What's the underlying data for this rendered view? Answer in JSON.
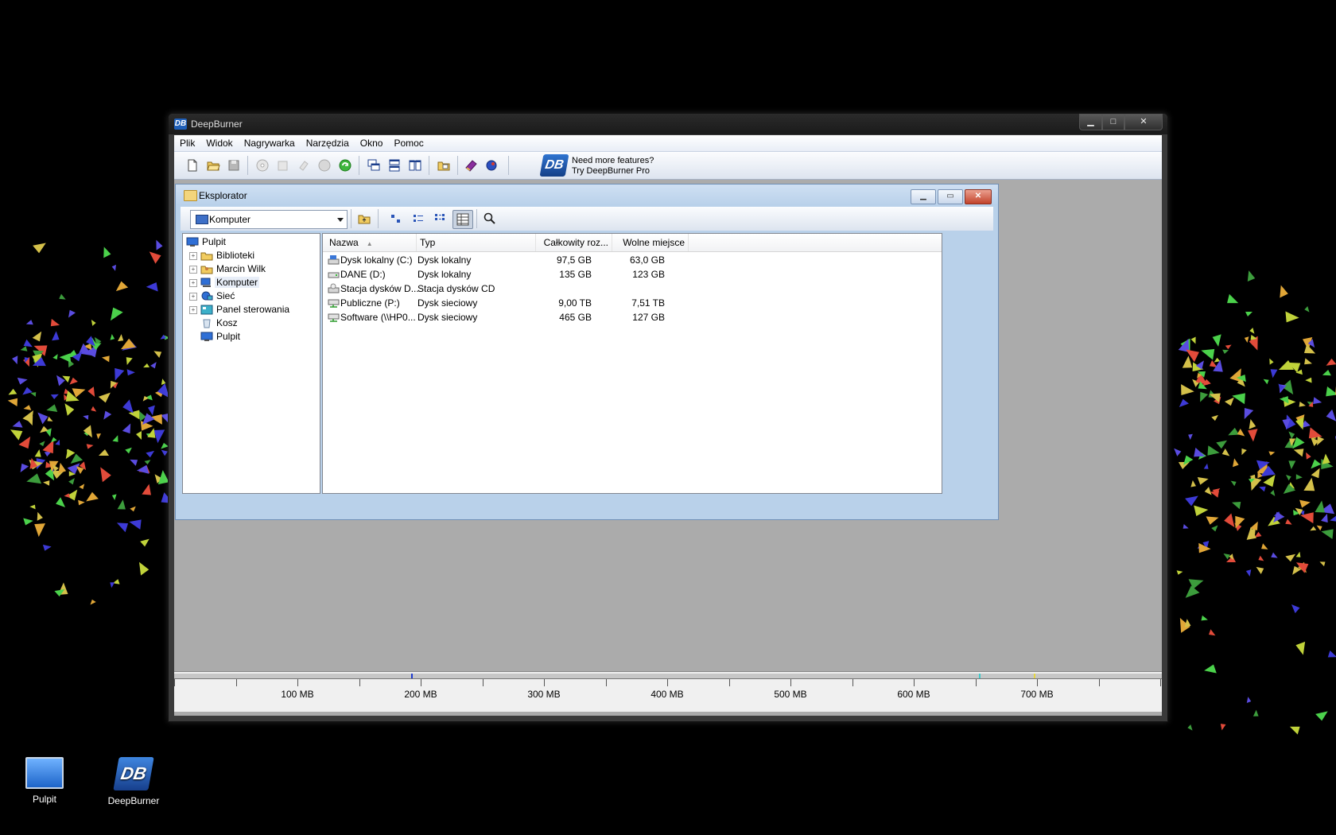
{
  "app": {
    "title": "DeepBurner",
    "logo_text": "DB"
  },
  "menu": [
    "Plik",
    "Widok",
    "Nagrywarka",
    "Narzędzia",
    "Okno",
    "Pomoc"
  ],
  "promo": {
    "line1": "Need more features?",
    "line2": "Try DeepBurner Pro",
    "logo": "DB"
  },
  "explorer": {
    "title": "Eksplorator",
    "location": "Komputer",
    "tree": [
      {
        "label": "Pulpit",
        "icon": "desktop-icon"
      },
      {
        "label": "Biblioteki",
        "icon": "libraries-icon"
      },
      {
        "label": "Marcin Wilk",
        "icon": "user-folder-icon"
      },
      {
        "label": "Komputer",
        "icon": "computer-icon"
      },
      {
        "label": "Sieć",
        "icon": "network-icon"
      },
      {
        "label": "Panel sterowania",
        "icon": "control-panel-icon"
      },
      {
        "label": "Kosz",
        "icon": "recycle-bin-icon"
      },
      {
        "label": "Pulpit",
        "icon": "desktop-icon"
      }
    ],
    "columns": {
      "name": "Nazwa",
      "type": "Typ",
      "total": "Całkowity roz...",
      "free": "Wolne miejsce"
    },
    "rows": [
      {
        "name": "Dysk lokalny (C:)",
        "type": "Dysk lokalny",
        "total": "97,5 GB",
        "free": "63,0 GB",
        "icon": "system-drive-icon"
      },
      {
        "name": "DANE (D:)",
        "type": "Dysk lokalny",
        "total": "135 GB",
        "free": "123 GB",
        "icon": "drive-icon"
      },
      {
        "name": "Stacja dysków D...",
        "type": "Stacja dysków CD",
        "total": "",
        "free": "",
        "icon": "cd-drive-icon"
      },
      {
        "name": "Publiczne (P:)",
        "type": "Dysk sieciowy",
        "total": "9,00 TB",
        "free": "7,51 TB",
        "icon": "network-drive-icon"
      },
      {
        "name": "Software (\\\\HP0...",
        "type": "Dysk sieciowy",
        "total": "465 GB",
        "free": "127 GB",
        "icon": "network-drive-icon"
      }
    ]
  },
  "ruler": {
    "labels": [
      "100 MB",
      "200 MB",
      "300 MB",
      "400 MB",
      "500 MB",
      "600 MB",
      "700 MB"
    ]
  },
  "desktop": {
    "icons": [
      {
        "label": "Pulpit"
      },
      {
        "label": "DeepBurner"
      }
    ]
  }
}
